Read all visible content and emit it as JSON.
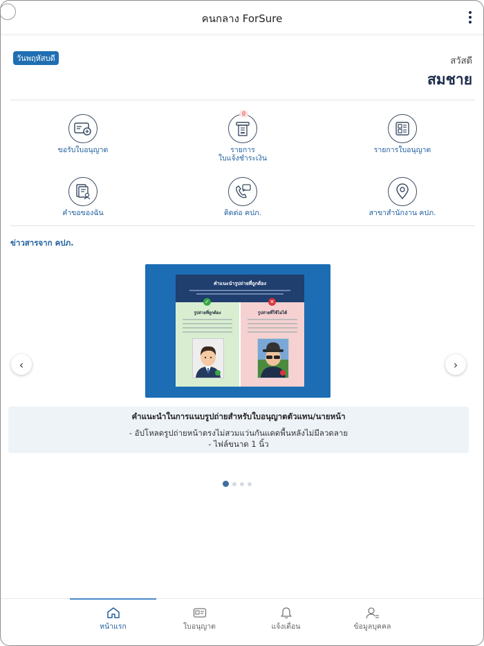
{
  "header": {
    "title": "คนกลาง ForSure"
  },
  "greeting": {
    "day": "วันพฤหัสบดี",
    "hello": "สวัสดี",
    "name": "สมชาย"
  },
  "menu": [
    {
      "label": "ขอรับใบอนุญาต",
      "icon": "license-card-add-icon"
    },
    {
      "label": "รายการ\nใบแจ้งชำระเงิน",
      "icon": "payment-slip-icon",
      "badge": "0"
    },
    {
      "label": "รายการใบอนุญาต",
      "icon": "license-list-icon"
    },
    {
      "label": "คำขอของฉัน",
      "icon": "my-requests-icon"
    },
    {
      "label": "ติดต่อ คปภ.",
      "icon": "contact-phone-icon"
    },
    {
      "label": "สาขาสำนักงาน คปภ.",
      "icon": "location-pin-icon"
    }
  ],
  "news": {
    "title": "ข่าวสารจาก คปภ.",
    "banner": {
      "headline": "คำแนะนำรูปถ่ายที่ถูกต้อง",
      "correct": "รูปถ่ายที่ถูกต้อง",
      "incorrect": "รูปถ่ายที่ใช้ไม่ได้"
    },
    "caption_title": "คำแนะนำในการแนบรูปถ่ายสำหรับใบอนุญาตตัวแทน/นายหน้า",
    "caption_lines": [
      "- อัปโหลดรูปถ่ายหน้าตรงไม่สวมแว่นกันแดดพื้นหลังไม่มีลวดลาย",
      "- ไฟล์ขนาด 1 นิ้ว"
    ],
    "slide_count": 4,
    "active_slide": 1
  },
  "bottom_nav": [
    {
      "label": "หน้าแรก",
      "active": true
    },
    {
      "label": "ใบอนุญาต",
      "active": false
    },
    {
      "label": "แจ้งเตือน",
      "active": false
    },
    {
      "label": "ข้อมูลบุคคล",
      "active": false
    }
  ],
  "colors": {
    "accent": "#1f5f9e",
    "badge": "#1f6fb2",
    "banner_bg": "#1c6db3"
  }
}
